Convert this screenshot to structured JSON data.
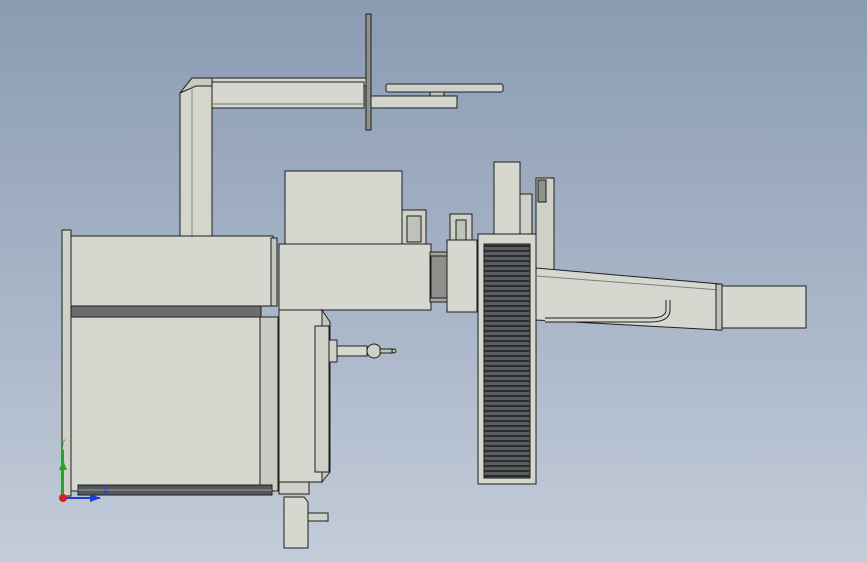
{
  "viewport": {
    "background_top": "#8a9bb2",
    "background_bottom": "#c3ccd9"
  },
  "model": {
    "part_fill": "#d6d8cf",
    "part_shade": "#bfc2b8",
    "edge_color": "#1e1e1e",
    "dark_fill": "#55585a"
  },
  "triad": {
    "y_label": "Y",
    "z_label": "Z",
    "y_color": "#1faa1f",
    "z_color": "#1f3fd9",
    "x_color": "#d42020"
  }
}
